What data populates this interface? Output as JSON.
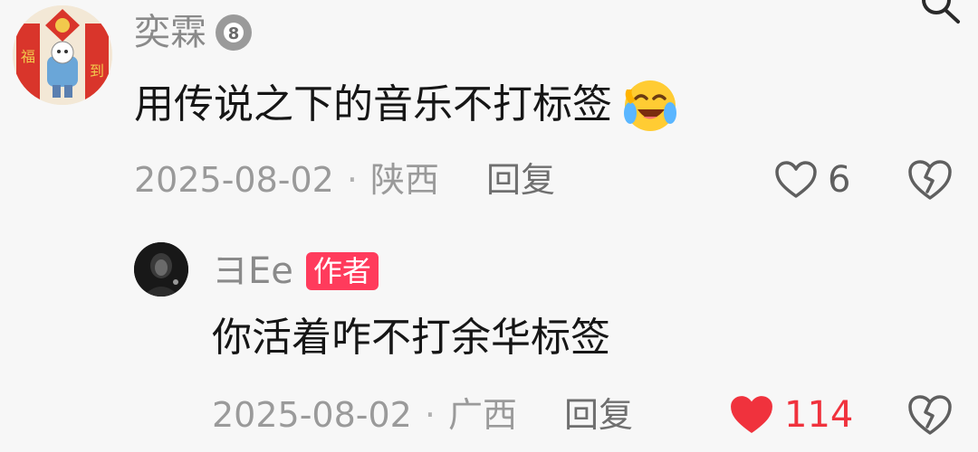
{
  "comment": {
    "username": "奕霖",
    "level_badge_icon": "billiard-8-ball-icon",
    "text": "用传说之下的音乐不打标签",
    "emoji_icon": "laughing-tears-emoji-icon",
    "date": "2025-08-02",
    "separator": "·",
    "location": "陕西",
    "reply_label": "回复",
    "like_count": "6",
    "liked": false
  },
  "reply": {
    "username": "ヨEe",
    "author_tag": "作者",
    "text": "你活着咋不打余华标签",
    "date": "2025-08-02",
    "separator": "·",
    "location": "广西",
    "reply_label": "回复",
    "like_count": "114",
    "liked": true
  },
  "colors": {
    "background": "#f7f7f7",
    "liked_red": "#f0323d",
    "author_tag_bg": "#ff3b5c"
  },
  "icons": {
    "top_right": "search-icon",
    "like": "heart-icon",
    "dislike": "broken-heart-icon"
  }
}
